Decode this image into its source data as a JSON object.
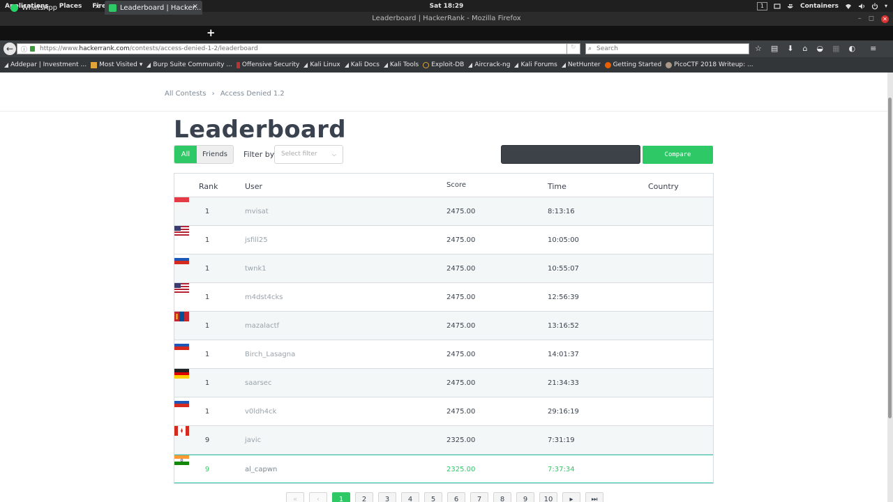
{
  "system_bar": {
    "applications": "Applications",
    "places": "Places",
    "firefox": "Firefox ESR",
    "clock": "Sat 18:29",
    "workspace": "1",
    "containers": "Containers"
  },
  "window": {
    "title": "Leaderboard | HackerRank - Mozilla Firefox"
  },
  "tabs": [
    {
      "label": "WhatsApp",
      "close": "×",
      "icon": "whatsapp-icon",
      "icon_color": "#25d366"
    },
    {
      "label": "Leaderboard | Hacker...",
      "close": "×",
      "icon": "hackerrank-icon",
      "icon_color": "#2ec866"
    }
  ],
  "new_tab": "+",
  "nav": {
    "url_prefix": "https://www.",
    "url_host": "hackerrank.com",
    "url_path": "/contests/access-denied-1-2/leaderboard",
    "search_placeholder": "Search"
  },
  "bookmarks": [
    {
      "label": "Addepar | Investment ...",
      "icon": "kali-icon"
    },
    {
      "label": "Most Visited",
      "icon": "folder-icon"
    },
    {
      "label": "Burp Suite Community ...",
      "icon": "kali-icon"
    },
    {
      "label": "Offensive Security",
      "icon": "offsec-icon"
    },
    {
      "label": "Kali Linux",
      "icon": "kali-icon"
    },
    {
      "label": "Kali Docs",
      "icon": "kali-icon"
    },
    {
      "label": "Kali Tools",
      "icon": "kali-icon"
    },
    {
      "label": "Exploit-DB",
      "icon": "exploitdb-icon"
    },
    {
      "label": "Aircrack-ng",
      "icon": "kali-icon"
    },
    {
      "label": "Kali Forums",
      "icon": "kali-icon"
    },
    {
      "label": "NetHunter",
      "icon": "kali-icon"
    },
    {
      "label": "Getting Started",
      "icon": "firefox-icon"
    },
    {
      "label": "PicoCTF 2018 Writeup: ...",
      "icon": "pico-icon"
    }
  ],
  "breadcrumb": {
    "root": "All Contests",
    "sep": "›",
    "current": "Access Denied 1.2"
  },
  "leaderboard": {
    "title": "Leaderboard",
    "seg_all": "All",
    "seg_friends": "Friends",
    "filter_label": "Filter by",
    "filter_placeholder": "Select filter",
    "filter_chevron": "⌵",
    "compare_label": "Compare",
    "columns": {
      "rank": "Rank",
      "user": "User",
      "score": "Score",
      "time": "Time",
      "country": "Country"
    },
    "rows": [
      {
        "rank": "1",
        "user": "mvisat",
        "score": "2475.00",
        "time": "8:13:16",
        "flag": "indonesia"
      },
      {
        "rank": "1",
        "user": "jsfill25",
        "score": "2475.00",
        "time": "10:05:00",
        "flag": "usa"
      },
      {
        "rank": "1",
        "user": "twnk1",
        "score": "2475.00",
        "time": "10:55:07",
        "flag": "russia"
      },
      {
        "rank": "1",
        "user": "m4dst4cks",
        "score": "2475.00",
        "time": "12:56:39",
        "flag": "usa"
      },
      {
        "rank": "1",
        "user": "mazalactf",
        "score": "2475.00",
        "time": "13:16:52",
        "flag": "mongolia"
      },
      {
        "rank": "1",
        "user": "Birch_Lasagna",
        "score": "2475.00",
        "time": "14:01:37",
        "flag": "russia"
      },
      {
        "rank": "1",
        "user": "saarsec",
        "score": "2475.00",
        "time": "21:34:33",
        "flag": "germany"
      },
      {
        "rank": "1",
        "user": "v0ldh4ck",
        "score": "2475.00",
        "time": "29:16:19",
        "flag": "russia"
      },
      {
        "rank": "9",
        "user": "javic",
        "score": "2325.00",
        "time": "7:31:19",
        "flag": "canada"
      },
      {
        "rank": "9",
        "user": "al_capwn",
        "score": "2325.00",
        "time": "7:37:34",
        "flag": "india"
      }
    ]
  },
  "pagination": {
    "first": "«",
    "prev": "‹",
    "pages": [
      "1",
      "2",
      "3",
      "4",
      "5",
      "6",
      "7",
      "8",
      "9",
      "10"
    ],
    "current_page": "1",
    "next": "▸",
    "last": "⏭"
  },
  "colors": {
    "accent": "#2ec866",
    "title_text": "#39424e"
  }
}
